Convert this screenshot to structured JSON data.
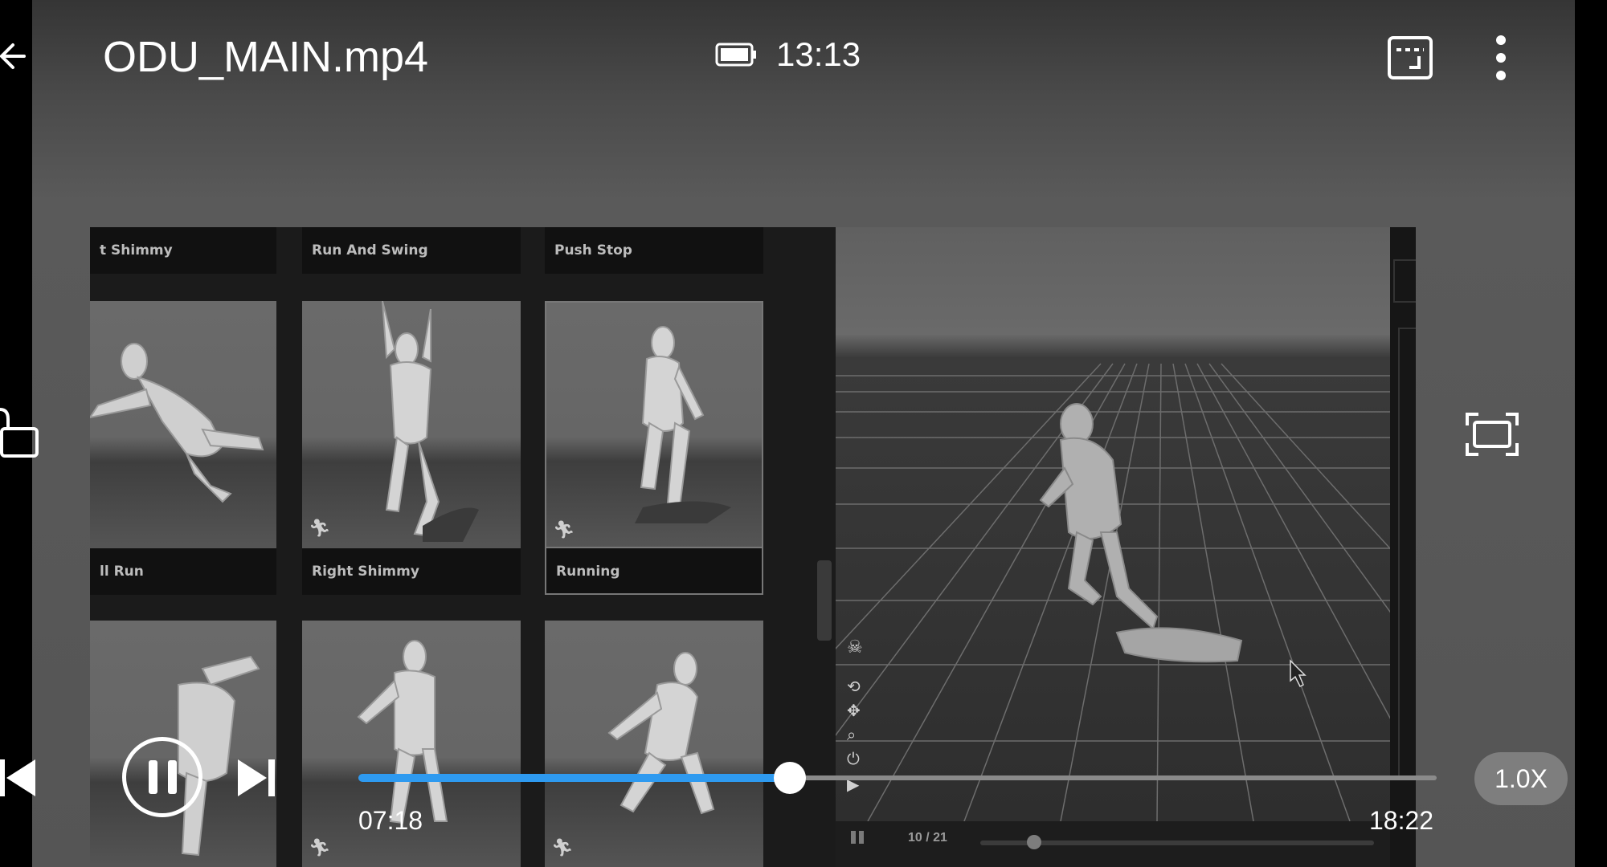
{
  "header": {
    "title": "ODU_MAIN.mp4",
    "clock": "13:13"
  },
  "video": {
    "library": {
      "row1_labels": [
        "t Shimmy",
        "Run And Swing",
        "Push Stop"
      ],
      "row2_labels": [
        "ll Run",
        "Right Shimmy",
        "Running"
      ]
    },
    "viewport": {
      "frame_counter": "10 / 21"
    }
  },
  "controls": {
    "time_current": "07:18",
    "time_total": "18:22",
    "speed": "1.0X",
    "progress": 0.4
  },
  "icons": {
    "back": "back-arrow-icon",
    "battery": "battery-icon",
    "screen_size": "aspect-ratio-icon",
    "more": "more-vert-icon",
    "lock": "unlock-icon",
    "screenshot": "capture-frame-icon",
    "prev": "skip-previous-icon",
    "pause": "pause-icon",
    "next": "skip-next-icon"
  }
}
